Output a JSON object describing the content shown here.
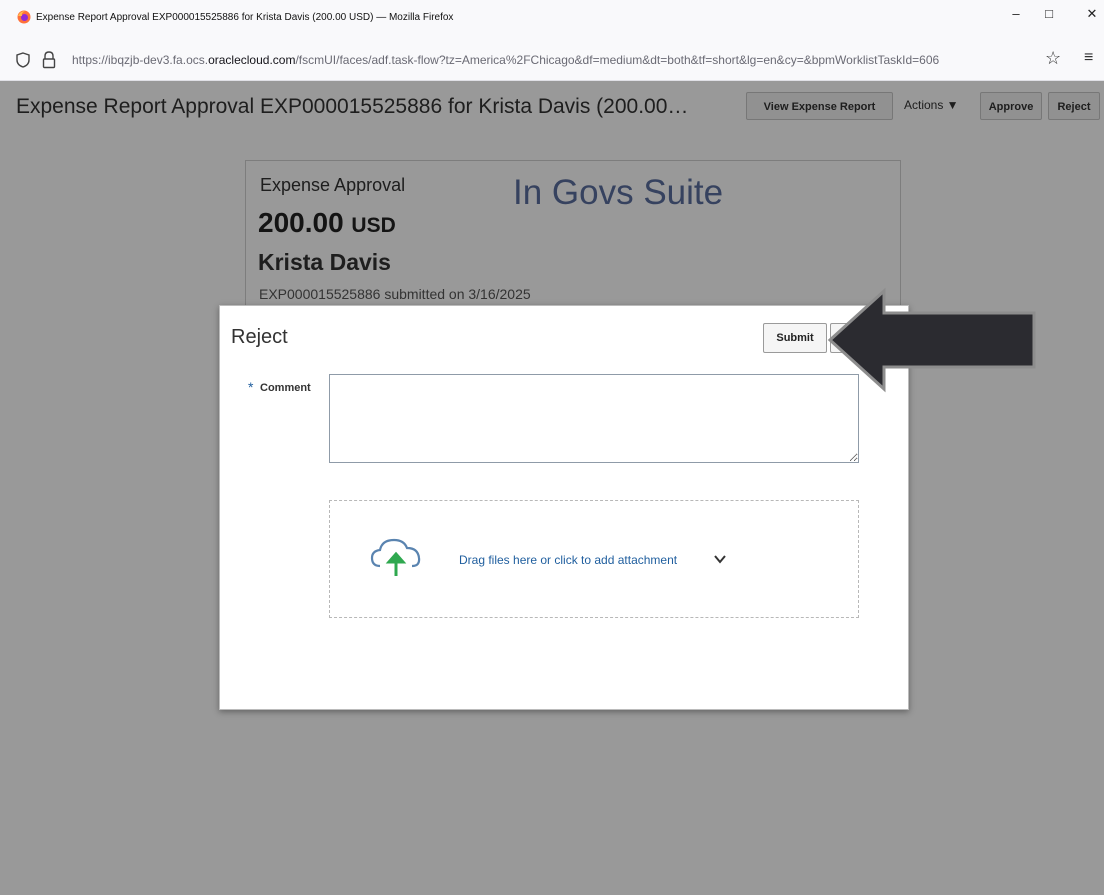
{
  "window": {
    "title": "Expense Report Approval EXP000015525886 for Krista Davis (200.00 USD) — Mozilla Firefox",
    "minimize": "–",
    "maximize": "□",
    "close": "✕"
  },
  "urlbar": {
    "url_prefix": "https://ibqzjb-dev3.fa.ocs.",
    "url_domain": "oraclecloud.com",
    "url_suffix": "/fscmUI/faces/adf.task-flow?tz=America%2FChicago&df=medium&dt=both&tf=short&lg=en&cy=&bpmWorklistTaskId=606",
    "star": "☆",
    "menu": "≡"
  },
  "header": {
    "title": "Expense Report Approval EXP000015525886 for Krista Davis (200.00…",
    "view_report": "View Expense Report",
    "actions": "Actions ▼",
    "approve": "Approve",
    "reject": "Reject"
  },
  "card": {
    "label": "Expense Approval",
    "amount": "200.00",
    "currency": "USD",
    "person": "Krista Davis",
    "submitted": "EXP000015525886 submitted on 3/16/2025",
    "watermark": "In Govs Suite"
  },
  "dialog": {
    "title": "Reject",
    "submit": "Submit",
    "required_mark": "*",
    "comment_label": "Comment",
    "comment_value": "",
    "attachment_text": "Drag files here or click to add attachment"
  },
  "colors": {
    "overlay": "#000000",
    "watermark": "#5b6e9e",
    "link": "#1f5e9e",
    "arrow": "#2b2b30"
  },
  "icons": [
    "firefox-icon",
    "shield-icon",
    "lock-icon",
    "star-icon",
    "menu-icon",
    "cloud-upload-icon",
    "chevron-down-icon",
    "arrow-annotation"
  ]
}
